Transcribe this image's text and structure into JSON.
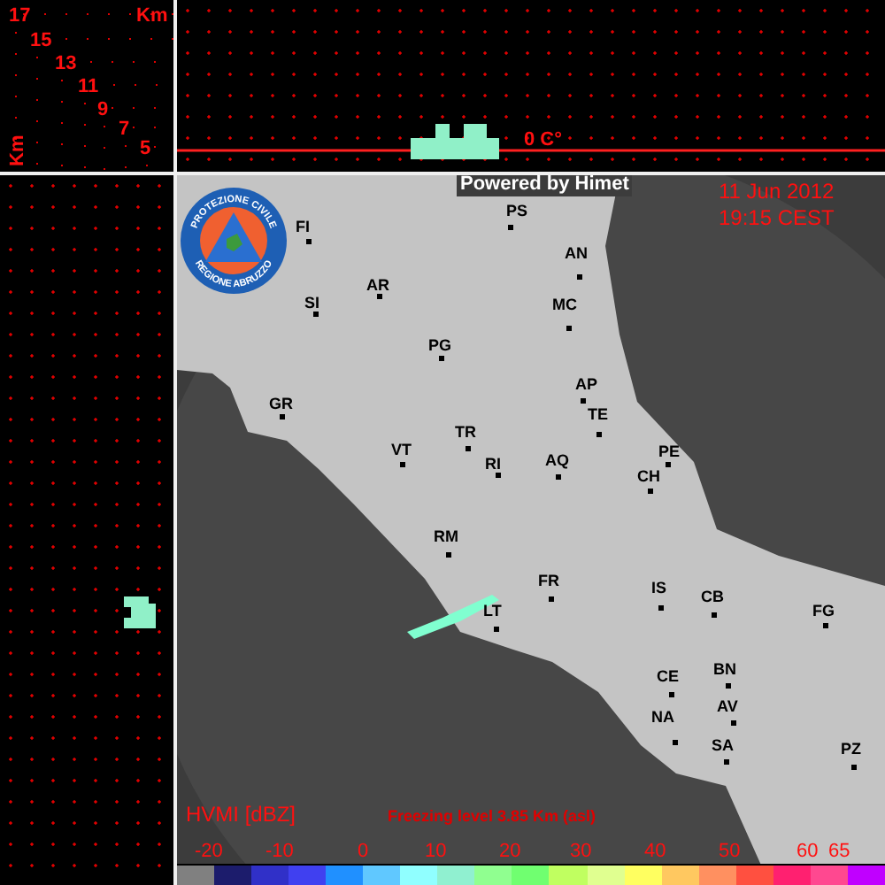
{
  "corner": {
    "axis_label_top": "Km",
    "axis_label_side": "Km",
    "height_labels": [
      "17",
      "15",
      "13",
      "11",
      "9",
      "7",
      "5"
    ]
  },
  "top_panel": {
    "freezing_label": "0 C°"
  },
  "map": {
    "credit": "Powered by Himet",
    "date": "11 Jun 2012",
    "time": "19:15 CEST",
    "logo": {
      "top_text": "PROTEZIONE CIVILE",
      "bottom_text": "REGIONE ABRUZZO"
    },
    "cities": [
      {
        "label": "FI"
      },
      {
        "label": "SI"
      },
      {
        "label": "AR"
      },
      {
        "label": "PS"
      },
      {
        "label": "PG"
      },
      {
        "label": "GR"
      },
      {
        "label": "VT"
      },
      {
        "label": "TR"
      },
      {
        "label": "RI"
      },
      {
        "label": "AN"
      },
      {
        "label": "MC"
      },
      {
        "label": "AP"
      },
      {
        "label": "TE"
      },
      {
        "label": "AQ"
      },
      {
        "label": "PE"
      },
      {
        "label": "CH"
      },
      {
        "label": "RM"
      },
      {
        "label": "FR"
      },
      {
        "label": "LT"
      },
      {
        "label": "IS"
      },
      {
        "label": "CB"
      },
      {
        "label": "FG"
      },
      {
        "label": "CE"
      },
      {
        "label": "BN"
      },
      {
        "label": "AV"
      },
      {
        "label": "NA"
      },
      {
        "label": "SA"
      },
      {
        "label": "PZ"
      }
    ]
  },
  "legend": {
    "title": "HVMI [dBZ]",
    "freezing_level": "Freezing level  3.85 Km (asl)",
    "ticks": [
      "-20",
      "-10",
      "0",
      "10",
      "20",
      "30",
      "40",
      "50",
      "60",
      "65"
    ],
    "swatches": [
      {
        "color": "#808080"
      },
      {
        "color": "#1c1c6c"
      },
      {
        "color": "#3030c8"
      },
      {
        "color": "#4040f0"
      },
      {
        "color": "#2090ff"
      },
      {
        "color": "#60c8ff"
      },
      {
        "color": "#90ffff"
      },
      {
        "color": "#90f0d0"
      },
      {
        "color": "#90ff90"
      },
      {
        "color": "#70ff70"
      },
      {
        "color": "#c0ff60"
      },
      {
        "color": "#e0ff90"
      },
      {
        "color": "#ffff60"
      },
      {
        "color": "#ffc860"
      },
      {
        "color": "#ff9060"
      },
      {
        "color": "#ff5040"
      },
      {
        "color": "#ff2070"
      },
      {
        "color": "#ff4890"
      },
      {
        "color": "#c000ff"
      }
    ]
  }
}
